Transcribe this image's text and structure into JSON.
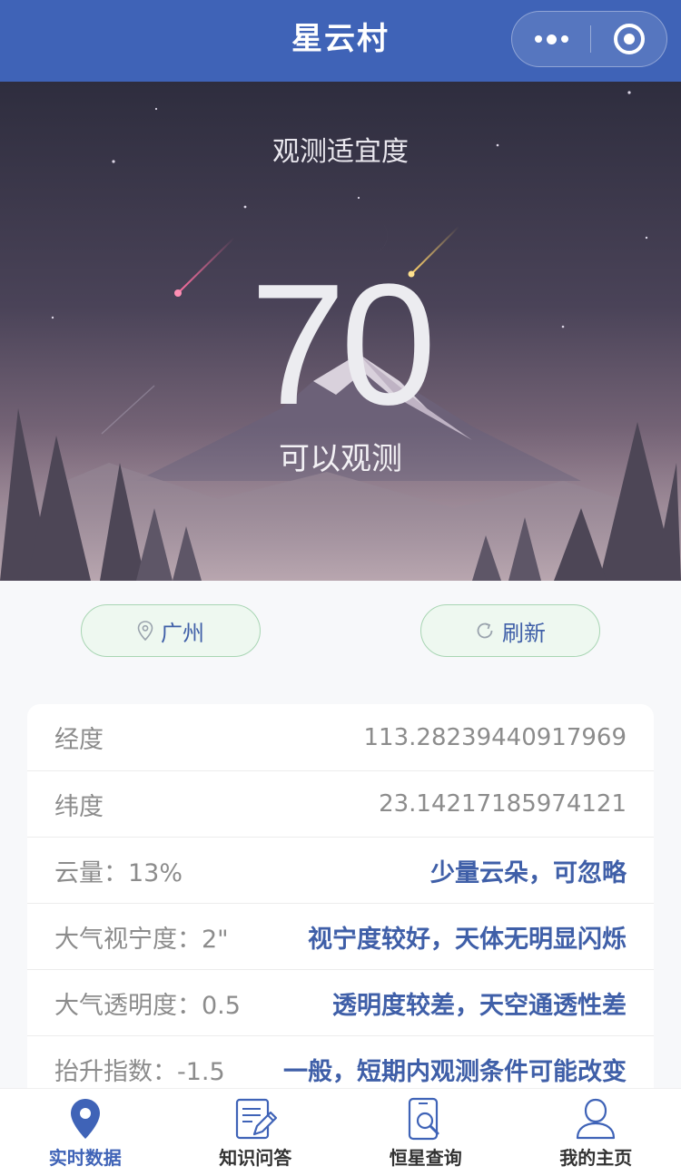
{
  "header": {
    "title": "星云村"
  },
  "hero": {
    "label": "观测适宜度",
    "score": "70",
    "status": "可以观测"
  },
  "actions": {
    "location_label": "广州",
    "refresh_label": "刷新"
  },
  "info_rows": [
    {
      "key": "经度",
      "value": "113.28239440917969",
      "is_desc": false
    },
    {
      "key": "纬度",
      "value": "23.14217185974121",
      "is_desc": false
    },
    {
      "key": "云量：13%",
      "value": "少量云朵，可忽略",
      "is_desc": true
    },
    {
      "key": "大气视宁度：2\"",
      "value": "视宁度较好，天体无明显闪烁",
      "is_desc": true
    },
    {
      "key": "大气透明度：0.5",
      "value": "透明度较差，天空通透性差",
      "is_desc": true
    },
    {
      "key": "抬升指数：-1.5",
      "value": "一般，短期内观测条件可能改变",
      "is_desc": true
    }
  ],
  "tabbar": [
    {
      "label": "实时数据",
      "icon": "location-pin-icon",
      "active": true
    },
    {
      "label": "知识问答",
      "icon": "edit-note-icon",
      "active": false
    },
    {
      "label": "恒星查询",
      "icon": "phone-search-icon",
      "active": false
    },
    {
      "label": "我的主页",
      "icon": "user-icon",
      "active": false
    }
  ],
  "colors": {
    "primary": "#3f63b7",
    "accent_text": "#3f5fa8",
    "button_bg": "#eef8f0",
    "button_border": "#a8d5b3"
  }
}
